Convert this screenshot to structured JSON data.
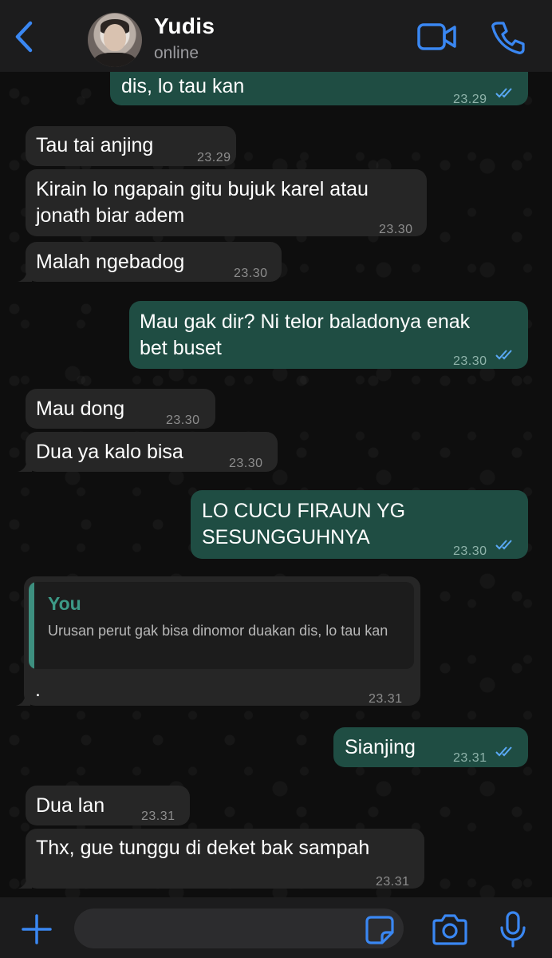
{
  "header": {
    "contact_name": "Yudis",
    "status": "online"
  },
  "colors": {
    "accent": "#3a87f2",
    "outgoing_bubble": "#1f4d43",
    "incoming_bubble": "#262626",
    "read_ticks": "#5aa9f5"
  },
  "messages": [
    {
      "direction": "out",
      "text": "dis, lo tau kan",
      "time": "23.29",
      "read": true
    },
    {
      "direction": "in",
      "text": "Tau tai anjing",
      "time": "23.29"
    },
    {
      "direction": "in",
      "text": "Kirain lo ngapain gitu bujuk karel atau\njonath biar adem",
      "time": "23.30"
    },
    {
      "direction": "in",
      "text": "Malah ngebadog",
      "time": "23.30"
    },
    {
      "direction": "out",
      "text": "Mau gak dir? Ni telor baladonya enak\nbet buset",
      "time": "23.30",
      "read": true
    },
    {
      "direction": "in",
      "text": "Mau dong",
      "time": "23.30"
    },
    {
      "direction": "in",
      "text": "Dua ya kalo bisa",
      "time": "23.30"
    },
    {
      "direction": "out",
      "text": "LO CUCU FIRAUN YG\nSESUNGGUHNYA",
      "time": "23.30",
      "read": true
    },
    {
      "direction": "in",
      "text": ".",
      "time": "23.31",
      "reply_to": {
        "author": "You",
        "text": "Urusan perut gak bisa dinomor duakan dis, lo tau kan"
      }
    },
    {
      "direction": "out",
      "text": "Sianjing",
      "time": "23.31",
      "read": true
    },
    {
      "direction": "in",
      "text": "Dua lan",
      "time": "23.31"
    },
    {
      "direction": "in",
      "text": "Thx, gue tunggu di deket bak sampah",
      "time": "23.31"
    }
  ],
  "composer": {
    "value": ""
  },
  "icons": {
    "back": "chevron-left-icon",
    "video": "video-camera-icon",
    "call": "phone-icon",
    "attach": "plus-icon",
    "sticker": "sticker-icon",
    "camera": "camera-icon",
    "mic": "microphone-icon"
  }
}
